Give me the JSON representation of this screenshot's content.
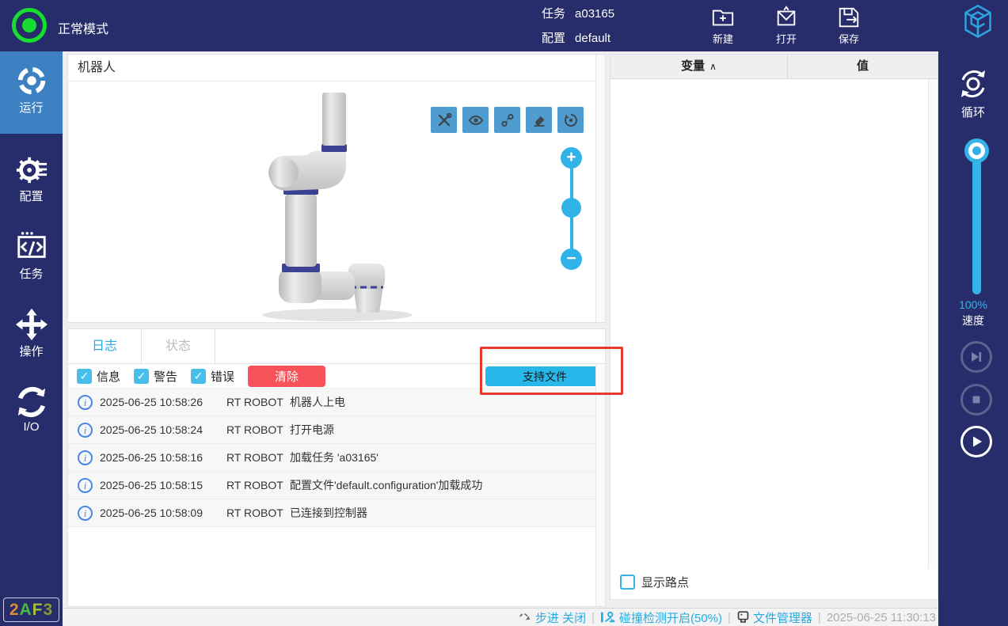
{
  "icons": {
    "check": "✓",
    "plus": "+",
    "minus": "−",
    "caret_up": "∧",
    "info": "i"
  },
  "topbar": {
    "mode": "正常模式",
    "task_label": "任务",
    "task_value": "a03165",
    "config_label": "配置",
    "config_value": "default",
    "actions": [
      {
        "label": "新建"
      },
      {
        "label": "打开"
      },
      {
        "label": "保存"
      }
    ]
  },
  "sidebar": {
    "items": [
      {
        "label": "运行"
      },
      {
        "label": "配置"
      },
      {
        "label": "任务"
      },
      {
        "label": "操作"
      },
      {
        "label": "I/O"
      }
    ],
    "badge_chars": [
      {
        "ch": "2",
        "style": "color:#dd8f2d"
      },
      {
        "ch": "A",
        "style": "color:#49b942"
      },
      {
        "ch": "F",
        "style": "color:#a3bf3a"
      },
      {
        "ch": "3",
        "style": "color:#8a9b31"
      }
    ]
  },
  "robot_panel": {
    "title": "机器人",
    "speed_zoom_tools": [
      "tools-icon",
      "eye-icon",
      "path-icon",
      "eraser-icon",
      "rotate-icon"
    ]
  },
  "log_panel": {
    "tabs": [
      {
        "label": "日志"
      },
      {
        "label": "状态"
      }
    ],
    "filters": [
      {
        "label": "信息",
        "checked": true
      },
      {
        "label": "警告",
        "checked": true
      },
      {
        "label": "错误",
        "checked": true
      }
    ],
    "clear_button": "清除",
    "support_button": "支持文件",
    "entries": [
      {
        "time": "2025-06-25 10:58:26",
        "source": "RT ROBOT",
        "message": "机器人上电"
      },
      {
        "time": "2025-06-25 10:58:24",
        "source": "RT ROBOT",
        "message": "打开电源"
      },
      {
        "time": "2025-06-25 10:58:16",
        "source": "RT ROBOT",
        "message": "加载任务 'a03165'"
      },
      {
        "time": "2025-06-25 10:58:15",
        "source": "RT ROBOT",
        "message": "配置文件'default.configuration'加载成功"
      },
      {
        "time": "2025-06-25 10:58:09",
        "source": "RT ROBOT",
        "message": "已连接到控制器"
      }
    ]
  },
  "variables_panel": {
    "col_variable": "变量",
    "col_value": "值",
    "show_waypoints": "显示路点"
  },
  "right_sidebar": {
    "loop_label": "循环",
    "speed_value": "100%",
    "speed_label": "速度"
  },
  "statusbar": {
    "step": "步进 关闭",
    "collision": "碰撞检测开启(50%)",
    "file_manager": "文件管理器",
    "time": "2025-06-25 11:30:13"
  },
  "colors": {
    "navy": "#272c6a",
    "cyan": "#29abe2",
    "active_blue": "#3e81c2",
    "tool_blue": "#4f9cd1",
    "red_button": "#f75159",
    "annotation_red": "#e5392b",
    "green": "#17dd2e"
  }
}
